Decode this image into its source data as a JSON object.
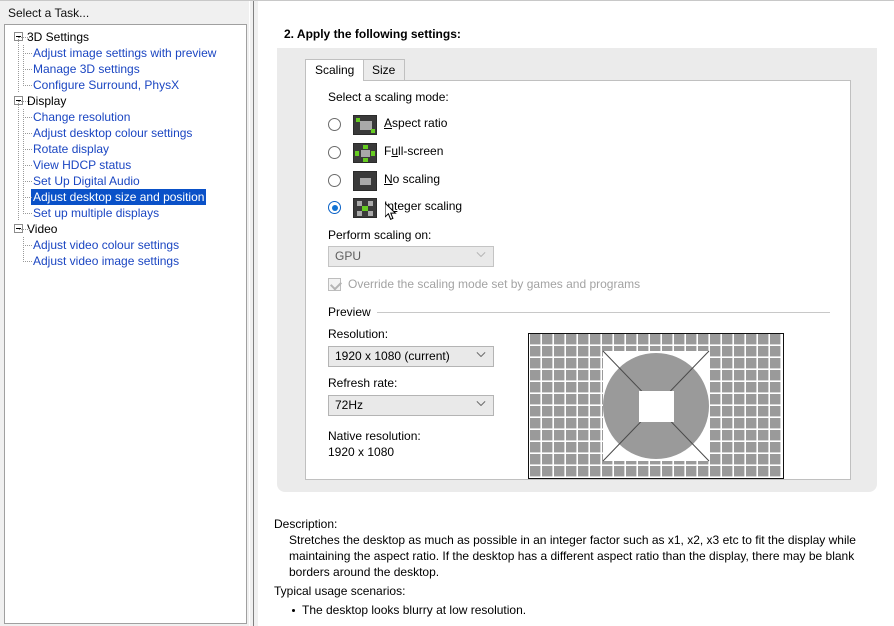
{
  "window": {
    "left_pane_title": "Select a Task...",
    "accent_selection": "#0a51c8",
    "link_color": "#1b46c2"
  },
  "sidebar": {
    "groups": [
      {
        "label": "3D Settings",
        "items": [
          {
            "label": "Adjust image settings with preview",
            "selected": false
          },
          {
            "label": "Manage 3D settings",
            "selected": false
          },
          {
            "label": "Configure Surround, PhysX",
            "selected": false
          }
        ]
      },
      {
        "label": "Display",
        "items": [
          {
            "label": "Change resolution",
            "selected": false
          },
          {
            "label": "Adjust desktop colour settings",
            "selected": false
          },
          {
            "label": "Rotate display",
            "selected": false
          },
          {
            "label": "View HDCP status",
            "selected": false
          },
          {
            "label": "Set Up Digital Audio",
            "selected": false
          },
          {
            "label": "Adjust desktop size and position",
            "selected": true
          },
          {
            "label": "Set up multiple displays",
            "selected": false
          }
        ]
      },
      {
        "label": "Video",
        "items": [
          {
            "label": "Adjust video colour settings",
            "selected": false
          },
          {
            "label": "Adjust video image settings",
            "selected": false
          }
        ]
      }
    ]
  },
  "main": {
    "step_title": "2. Apply the following settings:",
    "tabs": [
      {
        "id": "scaling",
        "label": "Scaling",
        "active": true
      },
      {
        "id": "size",
        "label": "Size",
        "active": false
      }
    ],
    "scaling": {
      "mode_label": "Select a scaling mode:",
      "modes": [
        {
          "label": "Aspect ratio",
          "icon": "aspect-ratio-icon",
          "selected": false
        },
        {
          "label": "Full-screen",
          "icon": "full-screen-icon",
          "selected": false
        },
        {
          "label": "No scaling",
          "icon": "no-scaling-icon",
          "selected": false
        },
        {
          "label": "Integer scaling",
          "icon": "integer-scaling-icon",
          "selected": true
        }
      ],
      "perform_on_label": "Perform scaling on:",
      "perform_on_value": "GPU",
      "perform_on_disabled": true,
      "override_label": "Override the scaling mode set by games and programs",
      "override_checked": true,
      "override_disabled": true
    },
    "preview": {
      "legend": "Preview",
      "resolution_label": "Resolution:",
      "resolution_value": "1920 x 1080 (current)",
      "refresh_label": "Refresh rate:",
      "refresh_value": "72Hz",
      "native_label": "Native resolution:",
      "native_value": "1920 x 1080"
    },
    "description": {
      "title": "Description:",
      "body": "Stretches the desktop as much as possible in an integer factor such as x1, x2, x3 etc to fit the display while maintaining the aspect ratio. If the desktop has a different aspect ratio than the display, there may be blank borders around the desktop.",
      "usage_title": "Typical usage scenarios:",
      "usage_items": [
        "The desktop looks blurry at low resolution."
      ]
    }
  }
}
